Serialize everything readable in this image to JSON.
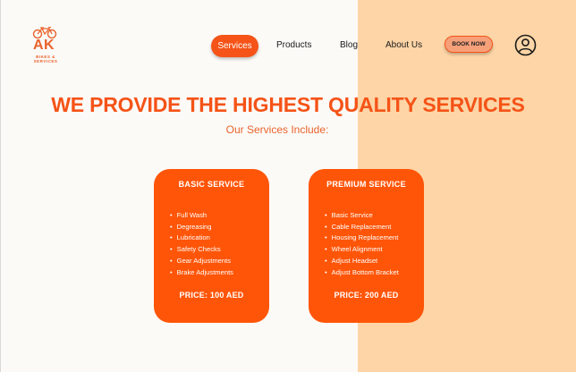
{
  "logo": {
    "text": "AK",
    "subtitle": "BIKES & SERVICES"
  },
  "nav": {
    "services": "Services",
    "products": "Products",
    "blog": "Blog",
    "about": "About Us",
    "book": "BOOK NOW"
  },
  "hero": {
    "headline": "WE PROVIDE THE HIGHEST QUALITY SERVICES",
    "subhead": "Our Services Include:"
  },
  "cards": [
    {
      "title": "BASIC SERVICE",
      "items": [
        "Full Wash",
        "Degreasing",
        "Lubrication",
        "Safety Checks",
        "Gear Adjustments",
        "Brake Adjustments"
      ],
      "price": "PRICE: 100 AED"
    },
    {
      "title": "PREMIUM SERVICE",
      "items": [
        "Basic Service",
        "Cable Replacement",
        "Housing Replacement",
        "Wheel Alignment",
        "Adjust Headset",
        "Adjust Bottom Bracket"
      ],
      "price": "PRICE: 200 AED"
    }
  ],
  "colors": {
    "accent": "#f55317",
    "peach": "#fdd5a6",
    "card": "#ff5508"
  },
  "icons": {
    "logo": "bicycle-icon",
    "account": "user-icon"
  }
}
